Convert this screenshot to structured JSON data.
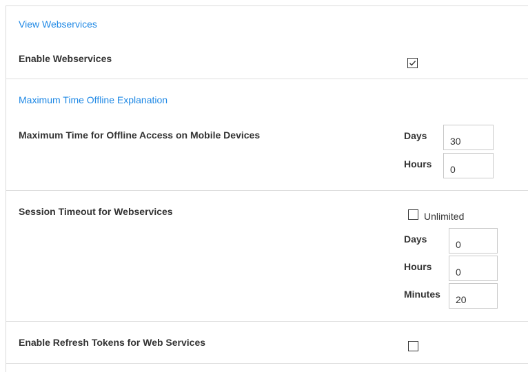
{
  "webservices": {
    "view_link": "View Webservices",
    "enable_label": "Enable Webservices",
    "enable_checked": true
  },
  "offline": {
    "explanation_link": "Maximum Time Offline Explanation",
    "label": "Maximum Time for Offline Access on Mobile Devices",
    "days_label": "Days",
    "days_value": "30",
    "hours_label": "Hours",
    "hours_value": "0"
  },
  "session": {
    "label": "Session Timeout for Webservices",
    "unlimited_label": "Unlimited",
    "unlimited_checked": false,
    "days_label": "Days",
    "days_value": "0",
    "hours_label": "Hours",
    "hours_value": "0",
    "minutes_label": "Minutes",
    "minutes_value": "20"
  },
  "refresh_tokens": {
    "label": "Enable Refresh Tokens for Web Services",
    "checked": false
  },
  "colors": {
    "link": "#1e88e5",
    "label": "#333333",
    "divider": "#dddddd"
  }
}
